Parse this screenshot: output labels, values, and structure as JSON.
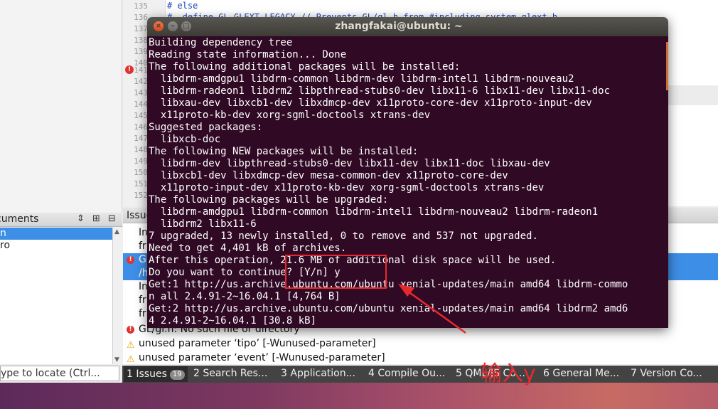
{
  "ide": {
    "code_numbers": [
      "135",
      "136",
      "137",
      "138",
      "139",
      "140",
      "141",
      "142",
      "143",
      "144",
      "145",
      "146",
      "147",
      "148",
      "149",
      "150",
      "151",
      "152"
    ],
    "code_lines": [
      "# else",
      "#  define GL_GLEXT_LEGACY // Prevents GL/gl.h from #including system glext.h"
    ],
    "documents_title": "cuments",
    "documents_items": [
      "n",
      "ro"
    ],
    "locate_placeholder": "ype to locate (Ctrl...",
    "issues_title": "Issue",
    "issue_rows": [
      {
        "kind": "none",
        "text": "In"
      },
      {
        "kind": "none",
        "text": "fr"
      },
      {
        "kind": "error",
        "text": "GL"
      },
      {
        "kind": "none",
        "text": "/h"
      },
      {
        "kind": "none",
        "text": "In"
      },
      {
        "kind": "none",
        "text": "fr"
      },
      {
        "kind": "none",
        "text": "fr"
      },
      {
        "kind": "error",
        "text": "GL/gl.h: No such file or directory"
      },
      {
        "kind": "warning",
        "text": "unused parameter ‘tipo’ [-Wunused-parameter]"
      },
      {
        "kind": "warning",
        "text": "unused parameter ‘event’ [-Wunused-parameter]"
      }
    ],
    "output_tabs": [
      {
        "num": "1",
        "label": "Issues",
        "badge": "19"
      },
      {
        "num": "2",
        "label": "Search Res..."
      },
      {
        "num": "3",
        "label": "Application..."
      },
      {
        "num": "4",
        "label": "Compile Ou..."
      },
      {
        "num": "5",
        "label": "QML/JS Co..."
      },
      {
        "num": "6",
        "label": "General Me..."
      },
      {
        "num": "7",
        "label": "Version Co..."
      }
    ]
  },
  "terminal": {
    "title": "zhangfakai@ubuntu: ~",
    "lines": [
      "Building dependency tree",
      "Reading state information... Done",
      "The following additional packages will be installed:",
      "  libdrm-amdgpu1 libdrm-common libdrm-dev libdrm-intel1 libdrm-nouveau2",
      "  libdrm-radeon1 libdrm2 libpthread-stubs0-dev libx11-6 libx11-dev libx11-doc",
      "  libxau-dev libxcb1-dev libxdmcp-dev x11proto-core-dev x11proto-input-dev",
      "  x11proto-kb-dev xorg-sgml-doctools xtrans-dev",
      "Suggested packages:",
      "  libxcb-doc",
      "The following NEW packages will be installed:",
      "  libdrm-dev libpthread-stubs0-dev libx11-dev libx11-doc libxau-dev",
      "  libxcb1-dev libxdmcp-dev mesa-common-dev x11proto-core-dev",
      "  x11proto-input-dev x11proto-kb-dev xorg-sgml-doctools xtrans-dev",
      "The following packages will be upgraded:",
      "  libdrm-amdgpu1 libdrm-common libdrm-intel1 libdrm-nouveau2 libdrm-radeon1",
      "  libdrm2 libx11-6",
      "7 upgraded, 13 newly installed, 0 to remove and 537 not upgraded.",
      "Need to get 4,401 kB of archives.",
      "After this operation, 21.6 MB of additional disk space will be used.",
      "Do you want to continue? [Y/n] y",
      "Get:1 http://us.archive.ubuntu.com/ubuntu xenial-updates/main amd64 libdrm-commo",
      "n all 2.4.91-2~16.04.1 [4,764 B]",
      "Get:2 http://us.archive.ubuntu.com/ubuntu xenial-updates/main amd64 libdrm2 amd6",
      "4 2.4.91-2~16.04.1 [30.8 kB]"
    ]
  },
  "annotation": {
    "text": "输入y",
    "color": "#e8282d"
  },
  "colors": {
    "terminal_bg": "#300a24",
    "selection": "#3d8ee6"
  }
}
